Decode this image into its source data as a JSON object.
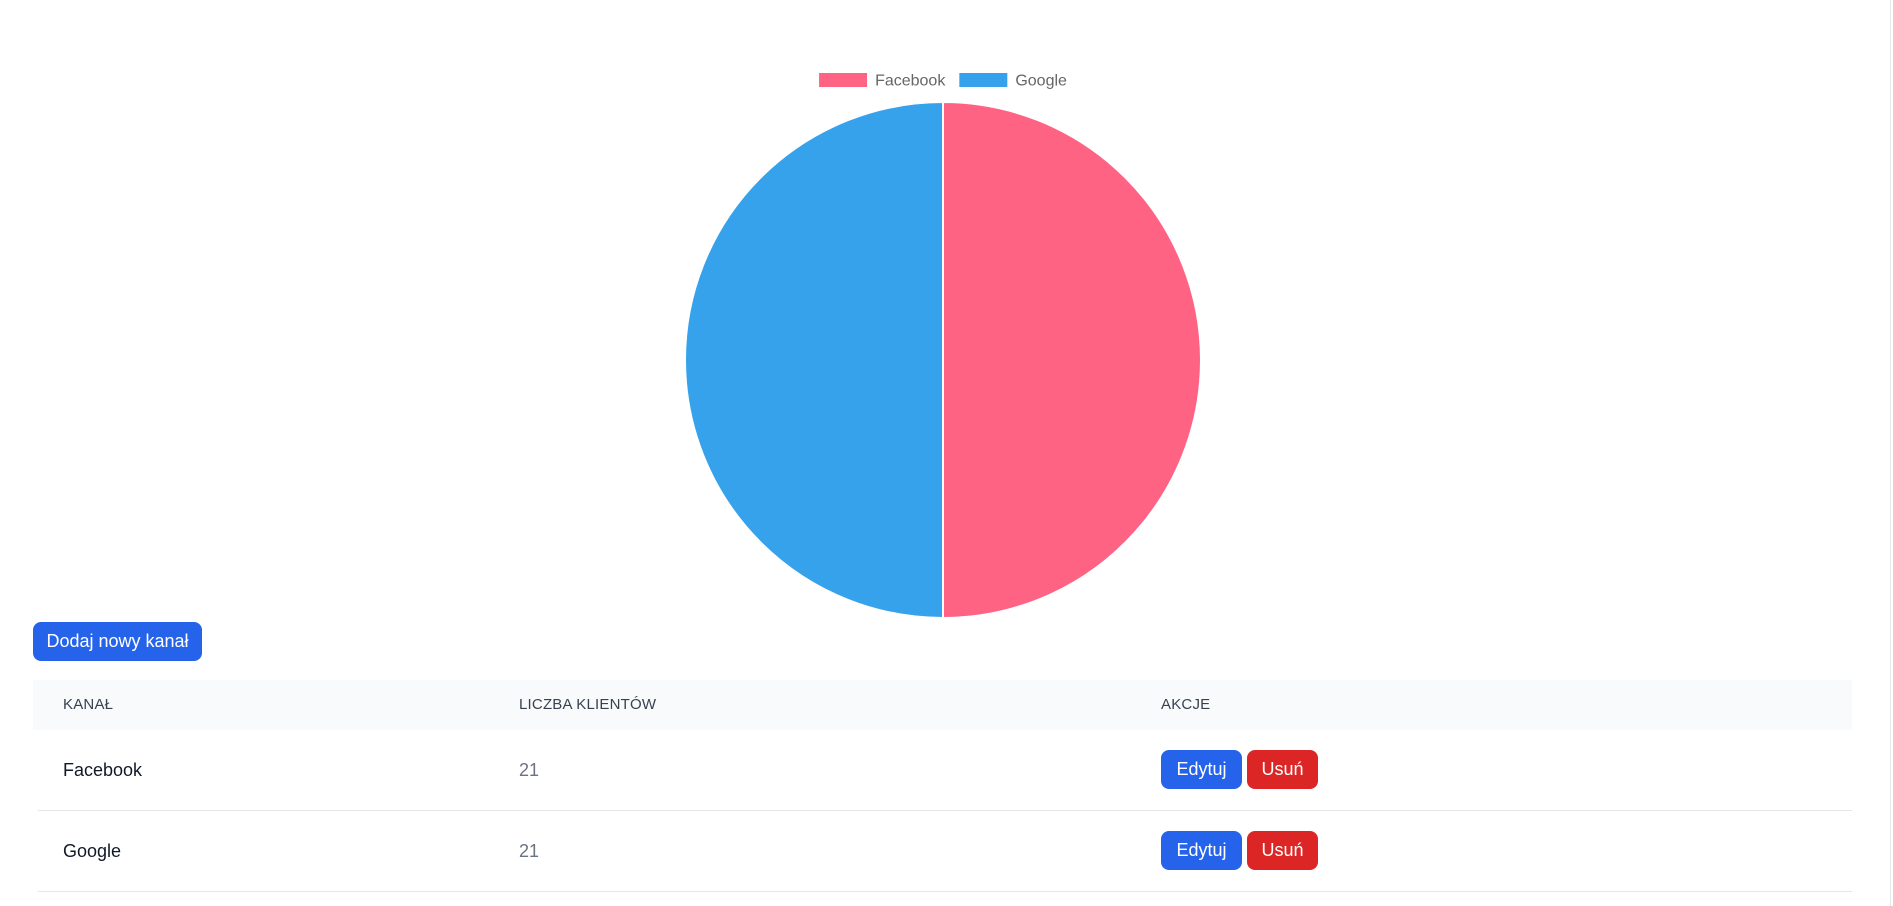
{
  "chart_data": {
    "type": "pie",
    "legend_position": "top",
    "slices": [
      {
        "label": "Facebook",
        "value": 21,
        "color": "#ff6384"
      },
      {
        "label": "Google",
        "value": 21,
        "color": "#36a2eb"
      }
    ]
  },
  "actions": {
    "add_label": "Dodaj nowy kanał"
  },
  "table": {
    "headers": [
      "KANAŁ",
      "LICZBA KLIENTÓW",
      "AKCJE"
    ],
    "rows": [
      {
        "channel": "Facebook",
        "count": "21",
        "edit_label": "Edytuj",
        "delete_label": "Usuń"
      },
      {
        "channel": "Google",
        "count": "21",
        "edit_label": "Edytuj",
        "delete_label": "Usuń"
      }
    ]
  }
}
